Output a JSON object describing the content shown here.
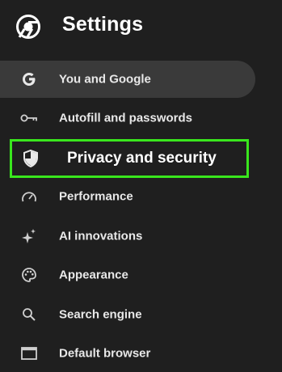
{
  "header": {
    "title": "Settings",
    "logo_icon": "chrome-logo-icon"
  },
  "nav": {
    "items": [
      {
        "label": "You and Google",
        "icon": "google-g-icon"
      },
      {
        "label": "Autofill and passwords",
        "icon": "key-icon"
      },
      {
        "label": "Privacy and security",
        "icon": "shield-icon"
      },
      {
        "label": "Performance",
        "icon": "speedometer-icon"
      },
      {
        "label": "AI innovations",
        "icon": "sparkle-icon"
      },
      {
        "label": "Appearance",
        "icon": "palette-icon"
      },
      {
        "label": "Search engine",
        "icon": "search-icon"
      },
      {
        "label": "Default browser",
        "icon": "browser-window-icon"
      }
    ]
  },
  "colors": {
    "background": "#1f1f1f",
    "active": "#3a3a3a",
    "highlight": "#39e61d"
  }
}
